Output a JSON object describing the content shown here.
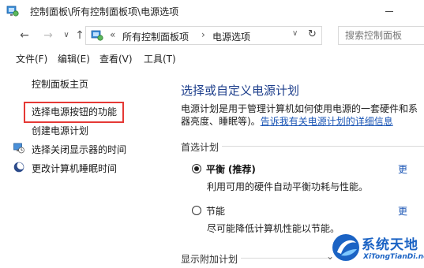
{
  "window": {
    "title": "控制面板\\所有控制面板项\\电源选项",
    "icon": "control-panel-icon"
  },
  "nav": {
    "back": "←",
    "forward": "→",
    "dropdown": "∨",
    "up": "↑"
  },
  "address": {
    "sep1": "«",
    "crumb1": "所有控制面板项",
    "sep2": "›",
    "crumb2": "电源选项",
    "dropdown": "∨",
    "refresh": "↻"
  },
  "search": {
    "placeholder": "搜索控制面板"
  },
  "menu": {
    "file": "文件(F)",
    "edit": "编辑(E)",
    "view": "查看(V)",
    "tools": "工具(T)"
  },
  "sidebar": {
    "home": "控制面板主页",
    "items": [
      {
        "label": "选择电源按钮的功能",
        "highlighted": true
      },
      {
        "label": "创建电源计划"
      },
      {
        "label": "选择关闭显示器的时间",
        "icon": "monitor-clock-icon"
      },
      {
        "label": "更改计算机睡眠时间",
        "icon": "moon-icon"
      }
    ]
  },
  "main": {
    "title": "选择或自定义电源计划",
    "description": "电源计划是用于管理计算机如何使用电源的一套硬件和系",
    "description_line2": "器亮度、睡眠等)。",
    "description_link": "告诉我有关电源计划的详细信息",
    "preferred_section": "首选计划",
    "plans": [
      {
        "name": "平衡",
        "tag": "(推荐)",
        "description": "利用可用的硬件自动平衡功耗与性能。",
        "selected": true,
        "more": "更"
      },
      {
        "name": "节能",
        "tag": "",
        "description": "尽可能降低计算机性能以节能。",
        "selected": false,
        "more": "更"
      }
    ],
    "additional_section": "显示附加计划"
  },
  "watermark": {
    "title": "系统天地",
    "subtitle": "XiTongTianDi.net"
  },
  "colors": {
    "highlight_border": "#e53935",
    "title_blue": "#1e3f8c",
    "link_blue": "#1a55b5"
  }
}
